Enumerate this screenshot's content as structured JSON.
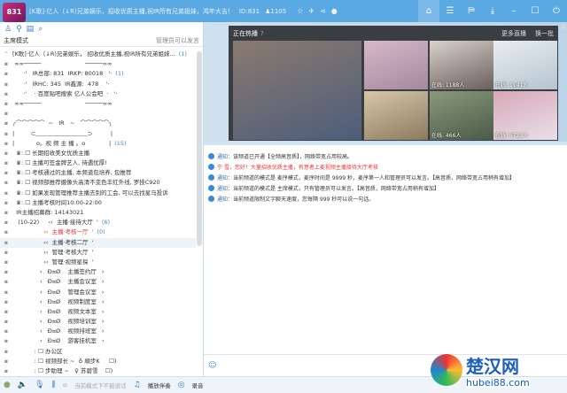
{
  "title": {
    "logo_text": "831",
    "room_name": "[K歌]·亿人（↓R)兄弟娱乐，招收优质主播,祝IR所有兄弟姐妹，鸿年大吉！",
    "id": "ID:831",
    "users": "1105",
    "icons": [
      "star-icon",
      "plane-icon",
      "share-icon",
      "location-icon"
    ],
    "right_icons": [
      "home-icon",
      "list-icon",
      "gift-icon",
      "download-icon",
      "minimize-icon",
      "maximize-icon",
      "power-icon"
    ]
  },
  "left": {
    "mode": "主席模式",
    "mode_note": "管理员可以发言",
    "rows": [
      {
        "t": "[K歌]·亿人（↓R)兄弟娱乐， 招收优质主播,祝IR所有兄弟姐妹...",
        "n": "(1)"
      },
      {
        "t": " ∞∞─────                        ─────∞∞",
        "n": ""
      },
      {
        "t": "      ·'   IR总部: 831  IRKP: 80018   '·",
        "n": "(1)"
      },
      {
        "t": "      ·'   IRHC: 345  IR鑫源:  478    '·",
        "n": ""
      },
      {
        "t": "      ·'    · 百度贴吧搜索 亿人公会吧  ·   '·",
        "n": ""
      },
      {
        "t": " ∞∞─────                        ─────∞∞",
        "n": ""
      },
      {
        "t": "",
        "n": ""
      },
      {
        "t": "╭⌒⌒⌒⌒⌒  ~   IR   ~   ⌒⌒⌒⌒⌒╮",
        "n": ""
      },
      {
        "t": "|         ⊂﹏﹏﹏﹏﹏﹏﹏﹏﹏⊃          |",
        "n": ""
      },
      {
        "t": "|            o。视 频 主 播 。o             |",
        "n": "(15)"
      },
      {
        "t": "  ♛: ☐ 长期招收美女优质主播",
        "n": ""
      },
      {
        "t": "  ♛: ☐ 主播可签金牌艺人, 待遇优厚!",
        "n": ""
      },
      {
        "t": "  ♛: ☐ 考核通过的主播, 本频道包培养, 包推荐",
        "n": ""
      },
      {
        "t": "  ♛: ☐ 视频部推荐摄像头高清不变色丰红外线, 罗技C920",
        "n": ""
      },
      {
        "t": "  ♛: ☐ 如果发现管理推荐主播去别的工会, 可以去找星马投诉",
        "n": ""
      },
      {
        "t": "  ♛: ☐ 主播考核时间10:00-22:00",
        "n": ""
      },
      {
        "t": "  IR主播招募群: 14143021",
        "n": ""
      },
      {
        "t": "   (10-22)     ‹‹  主播·接待大厅  '",
        "n": "(6)"
      },
      {
        "t": "                 ‹‹  主播·考核一厅  '",
        "n": "(0)"
      },
      {
        "t": "                 ‹‹  主播·考核二厅  '",
        "n": ""
      },
      {
        "t": "                 ‹‹  管理·考核大厅  '",
        "n": ""
      },
      {
        "t": "                 ‹‹  管理·视频星探  '",
        "n": ""
      },
      {
        "t": "               ‹   Ð¤Ø    主播签约厅   ›",
        "n": ""
      },
      {
        "t": "               ‹   Ð¤Ø    主播会议室   ›",
        "n": ""
      },
      {
        "t": "               ‹   Ð¤Ø    管理会议室   ›",
        "n": ""
      },
      {
        "t": "               ‹   Ð¤Ø    视频制度室   ›",
        "n": ""
      },
      {
        "t": "               ‹   Ð¤Ø    视频文本室   ›",
        "n": ""
      },
      {
        "t": "               ‹   Ð¤Ø    视频培训室   ›",
        "n": ""
      },
      {
        "t": "               ‹   Ð¤Ø    视频排班室   ›",
        "n": ""
      },
      {
        "t": "               ‹   Ð¤Ø    游客挂机室   ›",
        "n": ""
      },
      {
        "t": "            : ☐ 办公区",
        "n": ""
      },
      {
        "t": "            : ☐ 视频部长 ~  ♁ 順步K     ☐)",
        "n": ""
      },
      {
        "t": "            : ☐ 步助理 ~   ♀ 苏碧雪    ☐)",
        "n": ""
      }
    ]
  },
  "video": {
    "title": "正在热播",
    "more": "更多直播",
    "refresh": "换一批",
    "thumbs": [
      {
        "cap": ""
      },
      {
        "cap": ""
      },
      {
        "cap": "在线: 1188人"
      },
      {
        "cap": "在线: 1141人"
      },
      {
        "cap": ""
      },
      {
        "cap": "在线: 466人"
      },
      {
        "cap": "在线: 6723人"
      }
    ]
  },
  "chat": {
    "messages": [
      {
        "label": "通知：",
        "text": "该频道已开通【全频高音质】，网络带宽占用较高。",
        "red": false
      },
      {
        "label": "宁 雪，",
        "text": "您好！大量招收优质主播，有意者上麦视频主播接待大厅考核",
        "red": true
      },
      {
        "label": "通知：",
        "text": "当前频道的模式是 麦序模式，麦序时间是 9999 秒，麦序第一人和管理员可以发言。【高音质，网络带宽占用稍有增加】",
        "red": false
      },
      {
        "label": "通知：",
        "text": "当前频道的模式是 主席模式，只有管理员可以发言。【高音质，网络带宽占用稍有增加】",
        "red": false
      },
      {
        "label": "通知：",
        "text": "当前频道限制文字聊天速度，您每隔 999 秒可以说一句话。",
        "red": false
      }
    ]
  },
  "bottom": {
    "disabled_label": "当前模式下不能说话",
    "music": "播放伴奏",
    "record": "录音"
  },
  "watermark": {
    "cn": "楚汉网",
    "en": "hubei88.com"
  }
}
